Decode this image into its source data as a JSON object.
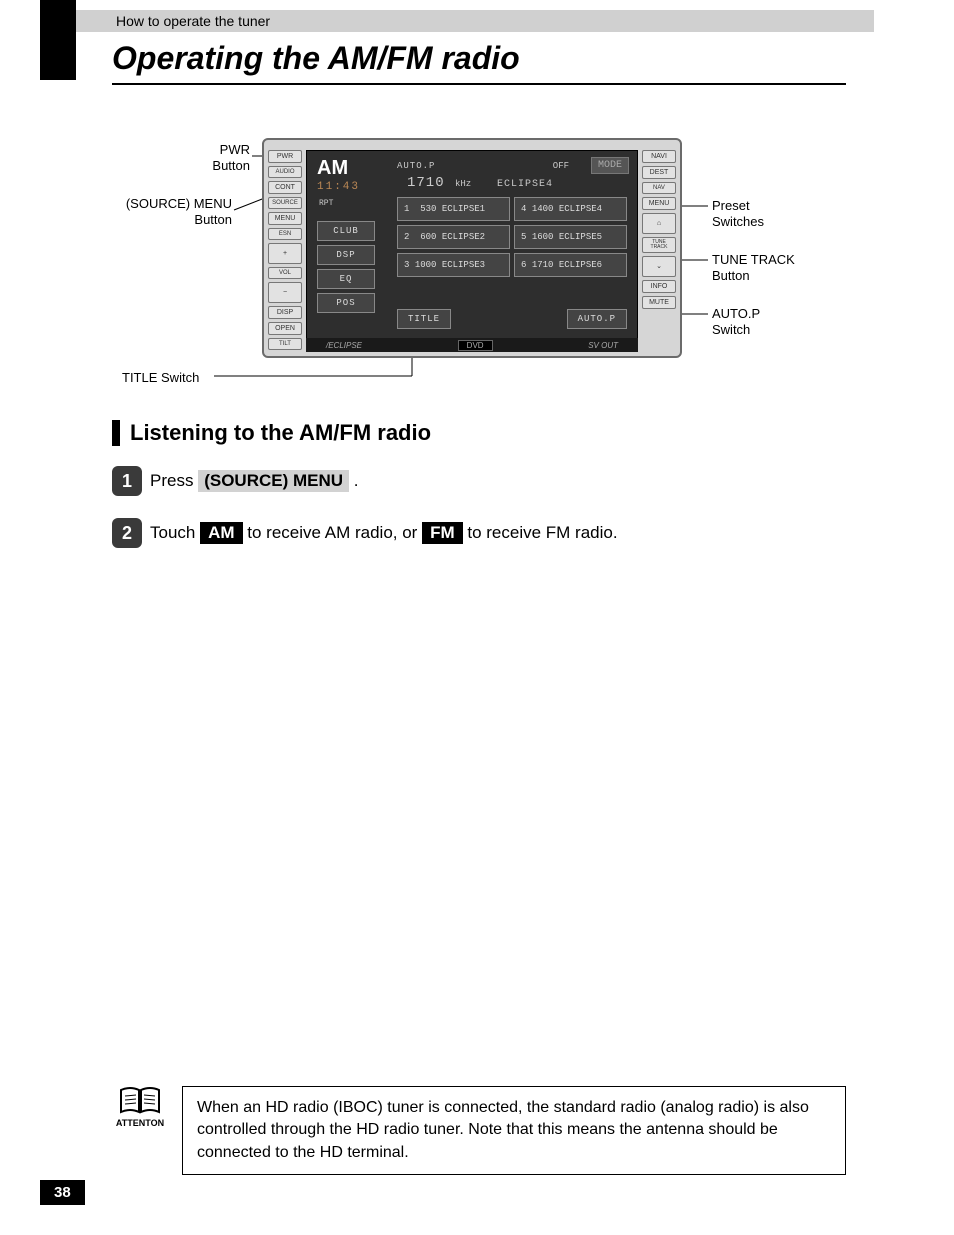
{
  "breadcrumb": "How to operate the tuner",
  "title": "Operating the AM/FM radio",
  "page_number": "38",
  "diagram": {
    "callouts": {
      "pwr": "PWR\nButton",
      "source_menu": "(SOURCE) MENU\nButton",
      "title_switch": "TITLE Switch",
      "preset": "Preset\nSwitches",
      "tune_track": "TUNE TRACK\nButton",
      "autop": "AUTO.P\nSwitch"
    },
    "hard_left": [
      "PWR",
      "AUDIO",
      "CONT",
      "SOURCE",
      "MENU",
      "ESN",
      "+",
      "VOL",
      "−",
      "DISP",
      "OPEN",
      "TILT"
    ],
    "hard_right": [
      "NAVI",
      "DEST",
      "NAV",
      "MENU",
      "⌂",
      "TUNE\nTRACK",
      "⌄",
      "INFO",
      "MUTE"
    ],
    "brand": {
      "left": "/ECLIPSE",
      "mid": "DVD",
      "right": "SV OUT"
    },
    "screen": {
      "band": "AM",
      "autop_top": "AUTO.P",
      "off": "OFF",
      "mode": "MODE",
      "time": "11:43",
      "freq": "1710",
      "khz": "kHz",
      "name": "ECLIPSE4",
      "rpt": "RPT",
      "side_buttons": [
        "CLUB",
        "DSP",
        "EQ",
        "POS"
      ],
      "presets": [
        {
          "n": "1",
          "f": "530",
          "t": "ECLIPSE1"
        },
        {
          "n": "4",
          "f": "1400",
          "t": "ECLIPSE4"
        },
        {
          "n": "2",
          "f": "600",
          "t": "ECLIPSE2"
        },
        {
          "n": "5",
          "f": "1600",
          "t": "ECLIPSE5"
        },
        {
          "n": "3",
          "f": "1000",
          "t": "ECLIPSE3"
        },
        {
          "n": "6",
          "f": "1710",
          "t": "ECLIPSE6"
        }
      ],
      "bottom": {
        "title": "TITLE",
        "autop": "AUTO.P"
      }
    }
  },
  "section_heading": "Listening to the AM/FM radio",
  "steps": {
    "s1_num": "1",
    "s1_a": "Press ",
    "s1_btn": "(SOURCE) MENU",
    "s1_b": " .",
    "s2_num": "2",
    "s2_a": "Touch ",
    "s2_am": "AM",
    "s2_b": " to receive AM radio, or ",
    "s2_fm": "FM",
    "s2_c": " to receive FM radio."
  },
  "attention": {
    "label": "ATTENTON",
    "text": "When an HD radio (IBOC) tuner is connected, the standard radio (analog radio) is also controlled through the HD radio tuner.  Note that this means the antenna should be connected to the HD terminal."
  }
}
